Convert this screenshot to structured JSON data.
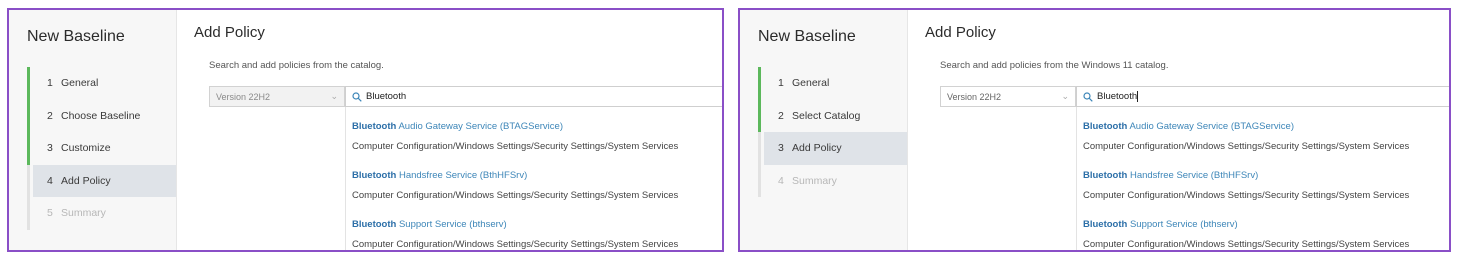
{
  "left": {
    "sidebar_title": "New Baseline",
    "steps": [
      {
        "num": "1",
        "label": "General"
      },
      {
        "num": "2",
        "label": "Choose Baseline"
      },
      {
        "num": "3",
        "label": "Customize"
      },
      {
        "num": "4",
        "label": "Add Policy"
      },
      {
        "num": "5",
        "label": "Summary"
      }
    ],
    "title": "Add Policy",
    "description": "Search and add policies from the catalog.",
    "version": "Version 22H2",
    "search_value": "Bluetooth",
    "results": [
      {
        "match": "Bluetooth",
        "rest": " Audio Gateway Service (BTAGService)",
        "path": "Computer Configuration/Windows Settings/Security Settings/System Services"
      },
      {
        "match": "Bluetooth",
        "rest": " Handsfree Service (BthHFSrv)",
        "path": "Computer Configuration/Windows Settings/Security Settings/System Services"
      },
      {
        "match": "Bluetooth",
        "rest": " Support Service (bthserv)",
        "path": "Computer Configuration/Windows Settings/Security Settings/System Services"
      }
    ]
  },
  "right": {
    "sidebar_title": "New Baseline",
    "steps": [
      {
        "num": "1",
        "label": "General"
      },
      {
        "num": "2",
        "label": "Select Catalog"
      },
      {
        "num": "3",
        "label": "Add Policy"
      },
      {
        "num": "4",
        "label": "Summary"
      }
    ],
    "title": "Add Policy",
    "description": "Search and add policies from the Windows 11 catalog.",
    "version": "Version 22H2",
    "search_value": "Bluetooth",
    "results": [
      {
        "match": "Bluetooth",
        "rest": " Audio Gateway Service (BTAGService)",
        "path": "Computer Configuration/Windows Settings/Security Settings/System Services"
      },
      {
        "match": "Bluetooth",
        "rest": " Handsfree Service (BthHFSrv)",
        "path": "Computer Configuration/Windows Settings/Security Settings/System Services"
      },
      {
        "match": "Bluetooth",
        "rest": " Support Service (bthserv)",
        "path": "Computer Configuration/Windows Settings/Security Settings/System Services"
      }
    ]
  },
  "colors": {
    "frame": "#8a4fc7",
    "progress": "#5cb85c",
    "link": "#3d86b8",
    "active_step": "#dfe3e8"
  },
  "icons": {
    "search": "search-icon",
    "dropdown": "chevron-down-icon"
  }
}
